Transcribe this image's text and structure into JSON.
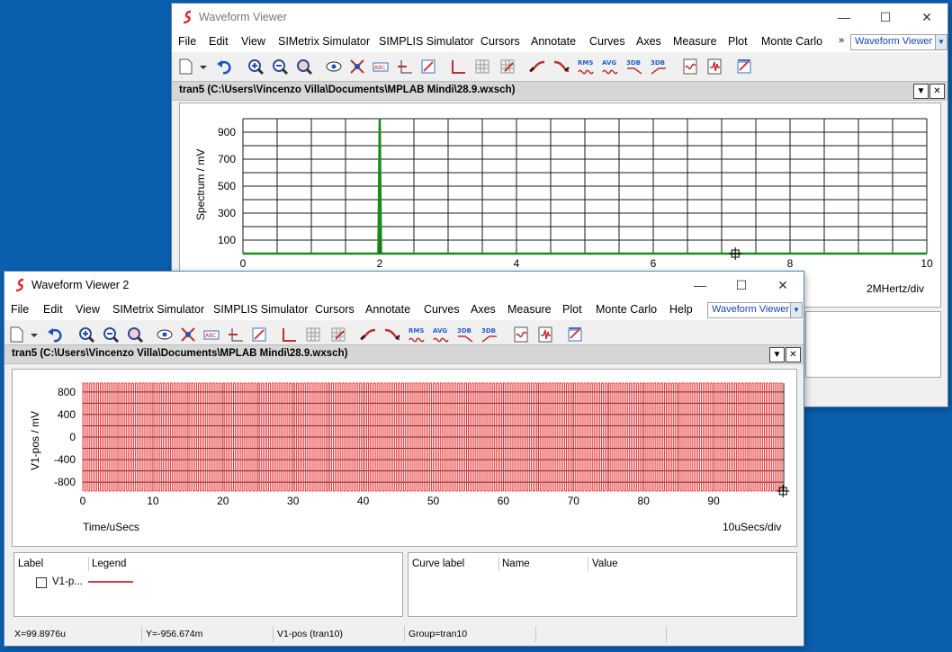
{
  "window1": {
    "title": "Waveform Viewer",
    "menu": [
      "File",
      "Edit",
      "View",
      "SIMetrix Simulator",
      "SIMPLIS Simulator",
      "Cursors",
      "Annotate",
      "Curves",
      "Axes",
      "Measure",
      "Plot",
      "Monte Carlo"
    ],
    "overflow": "»",
    "combo": "Waveform Viewer",
    "tab": "tran5 (C:\\Users\\Vincenzo Villa\\Documents\\MPLAB Mindi\\28.9.wxsch)",
    "ylabel": "Spectrum / mV",
    "yticks": [
      "900",
      "700",
      "500",
      "300",
      "100"
    ],
    "xticks": [
      "0",
      "2",
      "4",
      "6",
      "8",
      "10"
    ],
    "xunit": "2MHertz/div",
    "colors": {
      "trace": "#1c8a1c"
    }
  },
  "window2": {
    "title": "Waveform Viewer 2",
    "menu": [
      "File",
      "Edit",
      "View",
      "SIMetrix Simulator",
      "SIMPLIS Simulator",
      "Cursors",
      "Annotate",
      "Curves",
      "Axes",
      "Measure",
      "Plot",
      "Monte Carlo",
      "Help"
    ],
    "combo": "Waveform Viewer",
    "tab": "tran5 (C:\\Users\\Vincenzo Villa\\Documents\\MPLAB Mindi\\28.9.wxsch)",
    "ylabel": "V1-pos / mV",
    "yticks": [
      "800",
      "400",
      "0",
      "-400",
      "-800"
    ],
    "xticks": [
      "0",
      "10",
      "20",
      "30",
      "40",
      "50",
      "60",
      "70",
      "80",
      "90"
    ],
    "xlabel": "Time/uSecs",
    "xunit": "10uSecs/div",
    "legend": {
      "col_label": "Label",
      "col_legend": "Legend",
      "item_label": "V1-p..."
    },
    "curves": {
      "col_curve_label": "Curve label",
      "col_name": "Name",
      "col_value": "Value"
    },
    "status": {
      "x": "X=99.8976u",
      "y": "Y=-956.674m",
      "curve": "V1-pos (tran10)",
      "group": "Group=tran10"
    },
    "colors": {
      "trace": "#e8393b"
    }
  },
  "chart_data": [
    {
      "type": "line",
      "ylabel": "Spectrum / mV",
      "xunit": "2MHertz/div",
      "xlim": [
        0,
        10
      ],
      "ylim": [
        0,
        1000
      ],
      "grid": true,
      "series": [
        {
          "x": [
            0,
            1.98,
            2.0,
            2.02,
            10
          ],
          "values": [
            0,
            0,
            1000,
            0,
            0
          ]
        }
      ]
    },
    {
      "type": "line",
      "ylabel": "V1-pos / mV",
      "xlabel": "Time/uSecs",
      "xunit": "10uSecs/div",
      "xlim": [
        0,
        100
      ],
      "ylim": [
        -956.674,
        956.674
      ],
      "grid": true,
      "series": [
        {
          "name": "V1-pos",
          "description": "square wave, 2MHz, ±956.674 mV",
          "frequency_mhz": 2
        }
      ]
    }
  ]
}
